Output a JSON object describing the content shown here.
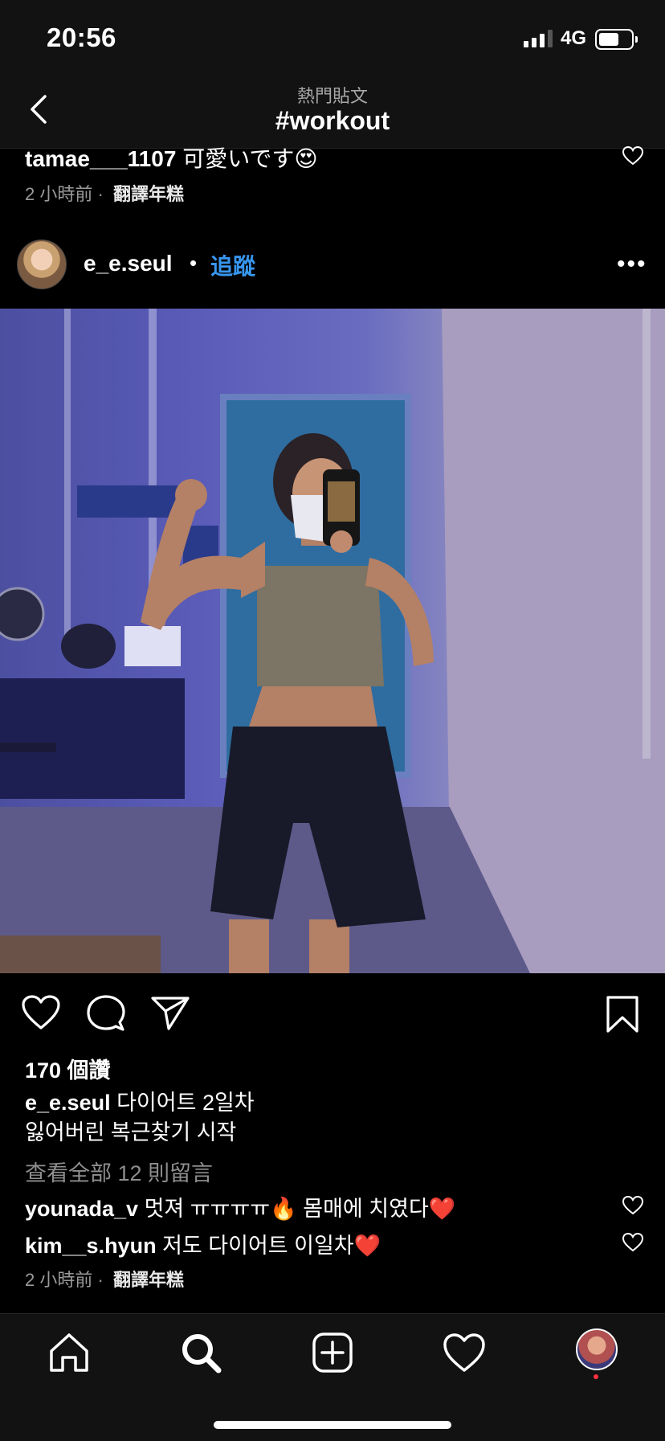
{
  "status_bar": {
    "time": "20:56",
    "network": "4G"
  },
  "nav": {
    "subtitle": "熱門貼文",
    "title": "#workout"
  },
  "previous_comment": {
    "username": "tamae___1107",
    "text": "可愛いです😍",
    "time": "2 小時前",
    "separator": "·",
    "translate": "翻譯年糕"
  },
  "post": {
    "username": "e_e.seul",
    "separator": "•",
    "follow_label": "追蹤",
    "more_label": "•••",
    "likes": "170 個讚",
    "caption_user": "e_e.seul",
    "caption_line1": "다이어트 2일차",
    "caption_line2": "잃어버린 복근찾기 시작",
    "view_all": "查看全部 12 則留言",
    "comments": [
      {
        "username": "younada_v",
        "text": "멋져 ㅠㅠㅠㅠ🔥 몸매에 치였다❤️"
      },
      {
        "username": "kim__s.hyun",
        "text": "저도 다이어트 이일차❤️"
      }
    ],
    "time": "2 小時前",
    "separator2": "·",
    "translate": "翻譯年糕"
  },
  "icons": {
    "back": "chevron-left-icon",
    "like": "heart-icon",
    "comment": "comment-icon",
    "share": "paper-plane-icon",
    "save": "bookmark-icon",
    "home": "home-icon",
    "search": "search-icon",
    "add": "plus-square-icon",
    "activity": "heart-icon"
  },
  "colors": {
    "accent": "#3897f0",
    "background": "#000000",
    "bar": "#121212",
    "notification": "#ff3040"
  }
}
